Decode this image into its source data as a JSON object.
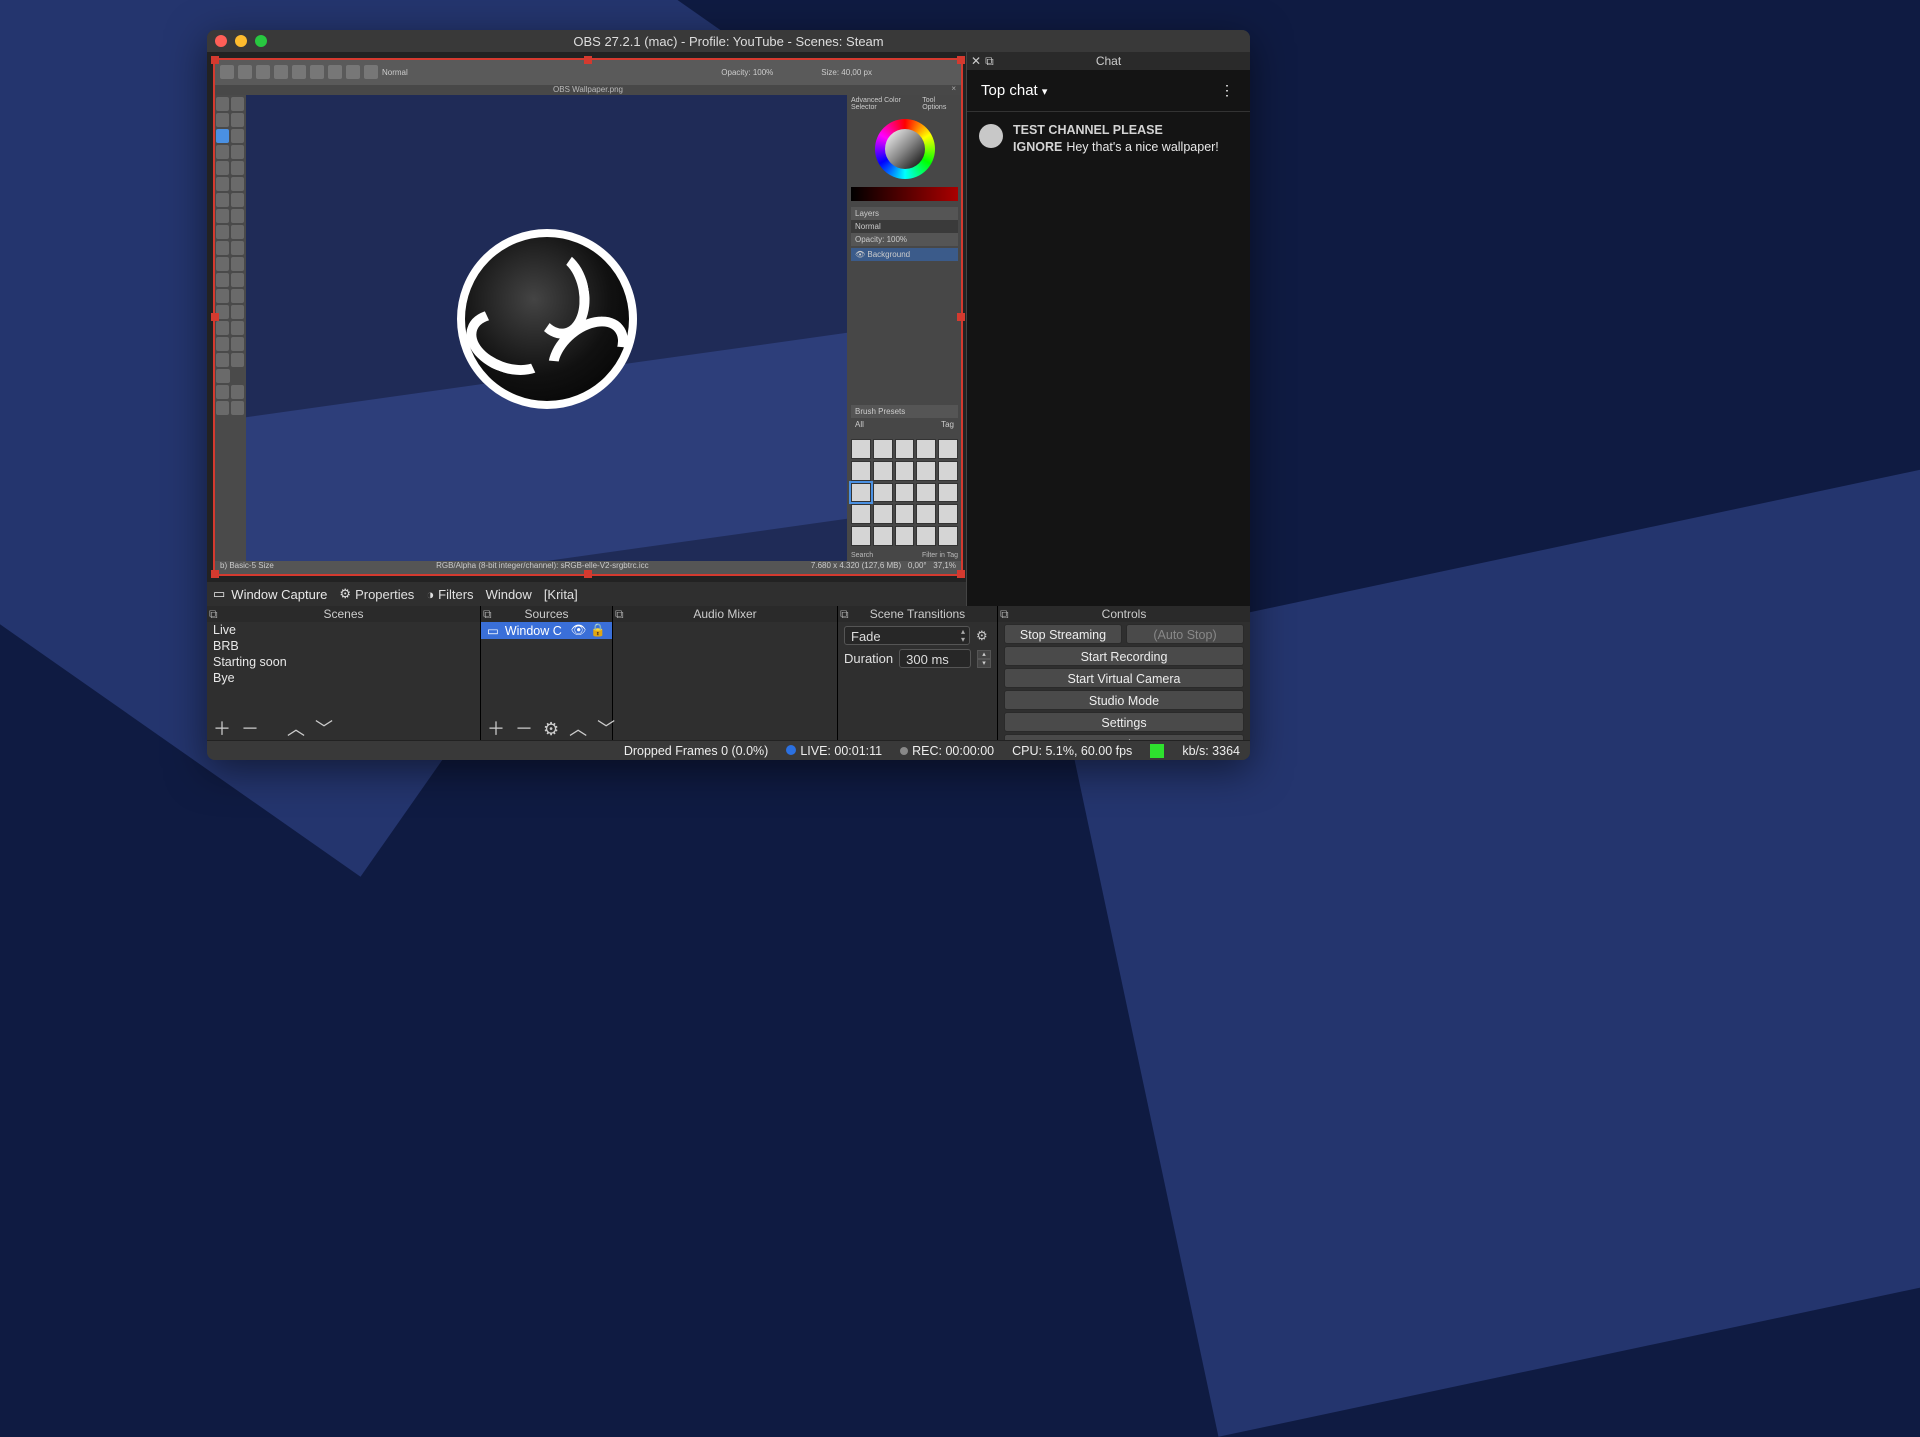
{
  "window": {
    "title": "OBS 27.2.1 (mac) - Profile: YouTube - Scenes: Steam"
  },
  "chat": {
    "panel_title": "Chat",
    "header": "Top chat",
    "messages": [
      {
        "user": "TEST CHANNEL PLEASE IGNORE",
        "body": "Hey that's a nice wallpaper!"
      }
    ]
  },
  "source_toolbar": {
    "selected_source": "Window Capture",
    "properties_label": "Properties",
    "filters_label": "Filters",
    "window_label": "Window",
    "window_value": "[Krita]"
  },
  "krita": {
    "tab_label": "OBS Wallpaper.png",
    "top_opacity": "Opacity: 100%",
    "top_size": "Size: 40,00 px",
    "top_mode": "Normal",
    "panel_ac": "Advanced Color Selector",
    "panel_to": "Tool Options",
    "layers_label": "Layers",
    "layers_mode": "Normal",
    "layer_opacity": "Opacity: 100%",
    "layer_name": "Background",
    "brush_label": "Brush Presets",
    "brush_all": "All",
    "brush_tag": "Tag",
    "search_label": "Search",
    "filter_label": "Filter in Tag",
    "status_left": "b) Basic-5 Size",
    "status_mid": "RGB/Alpha (8-bit integer/channel): sRGB-elle-V2-srgbtrc.icc",
    "status_r1": "7.680 x 4.320 (127,6 MB)",
    "status_r2": "0,00°",
    "status_r3": "37,1%"
  },
  "panels": {
    "scenes_title": "Scenes",
    "sources_title": "Sources",
    "mixer_title": "Audio Mixer",
    "transitions_title": "Scene Transitions",
    "controls_title": "Controls"
  },
  "scenes": [
    "Live",
    "BRB",
    "Starting soon",
    "Bye"
  ],
  "sources": [
    {
      "name": "Window C",
      "visible": true
    }
  ],
  "transitions": {
    "current": "Fade",
    "duration_label": "Duration",
    "duration_value": "300 ms"
  },
  "controls": {
    "stop_streaming": "Stop Streaming",
    "auto_stop": "(Auto Stop)",
    "start_recording": "Start Recording",
    "start_virtual": "Start Virtual Camera",
    "studio_mode": "Studio Mode",
    "settings": "Settings",
    "exit": "Exit"
  },
  "status": {
    "dropped": "Dropped Frames 0 (0.0%)",
    "live": "LIVE: 00:01:11",
    "rec": "REC: 00:00:00",
    "cpu": "CPU: 5.1%, 60.00 fps",
    "kbps": "kb/s: 3364"
  }
}
